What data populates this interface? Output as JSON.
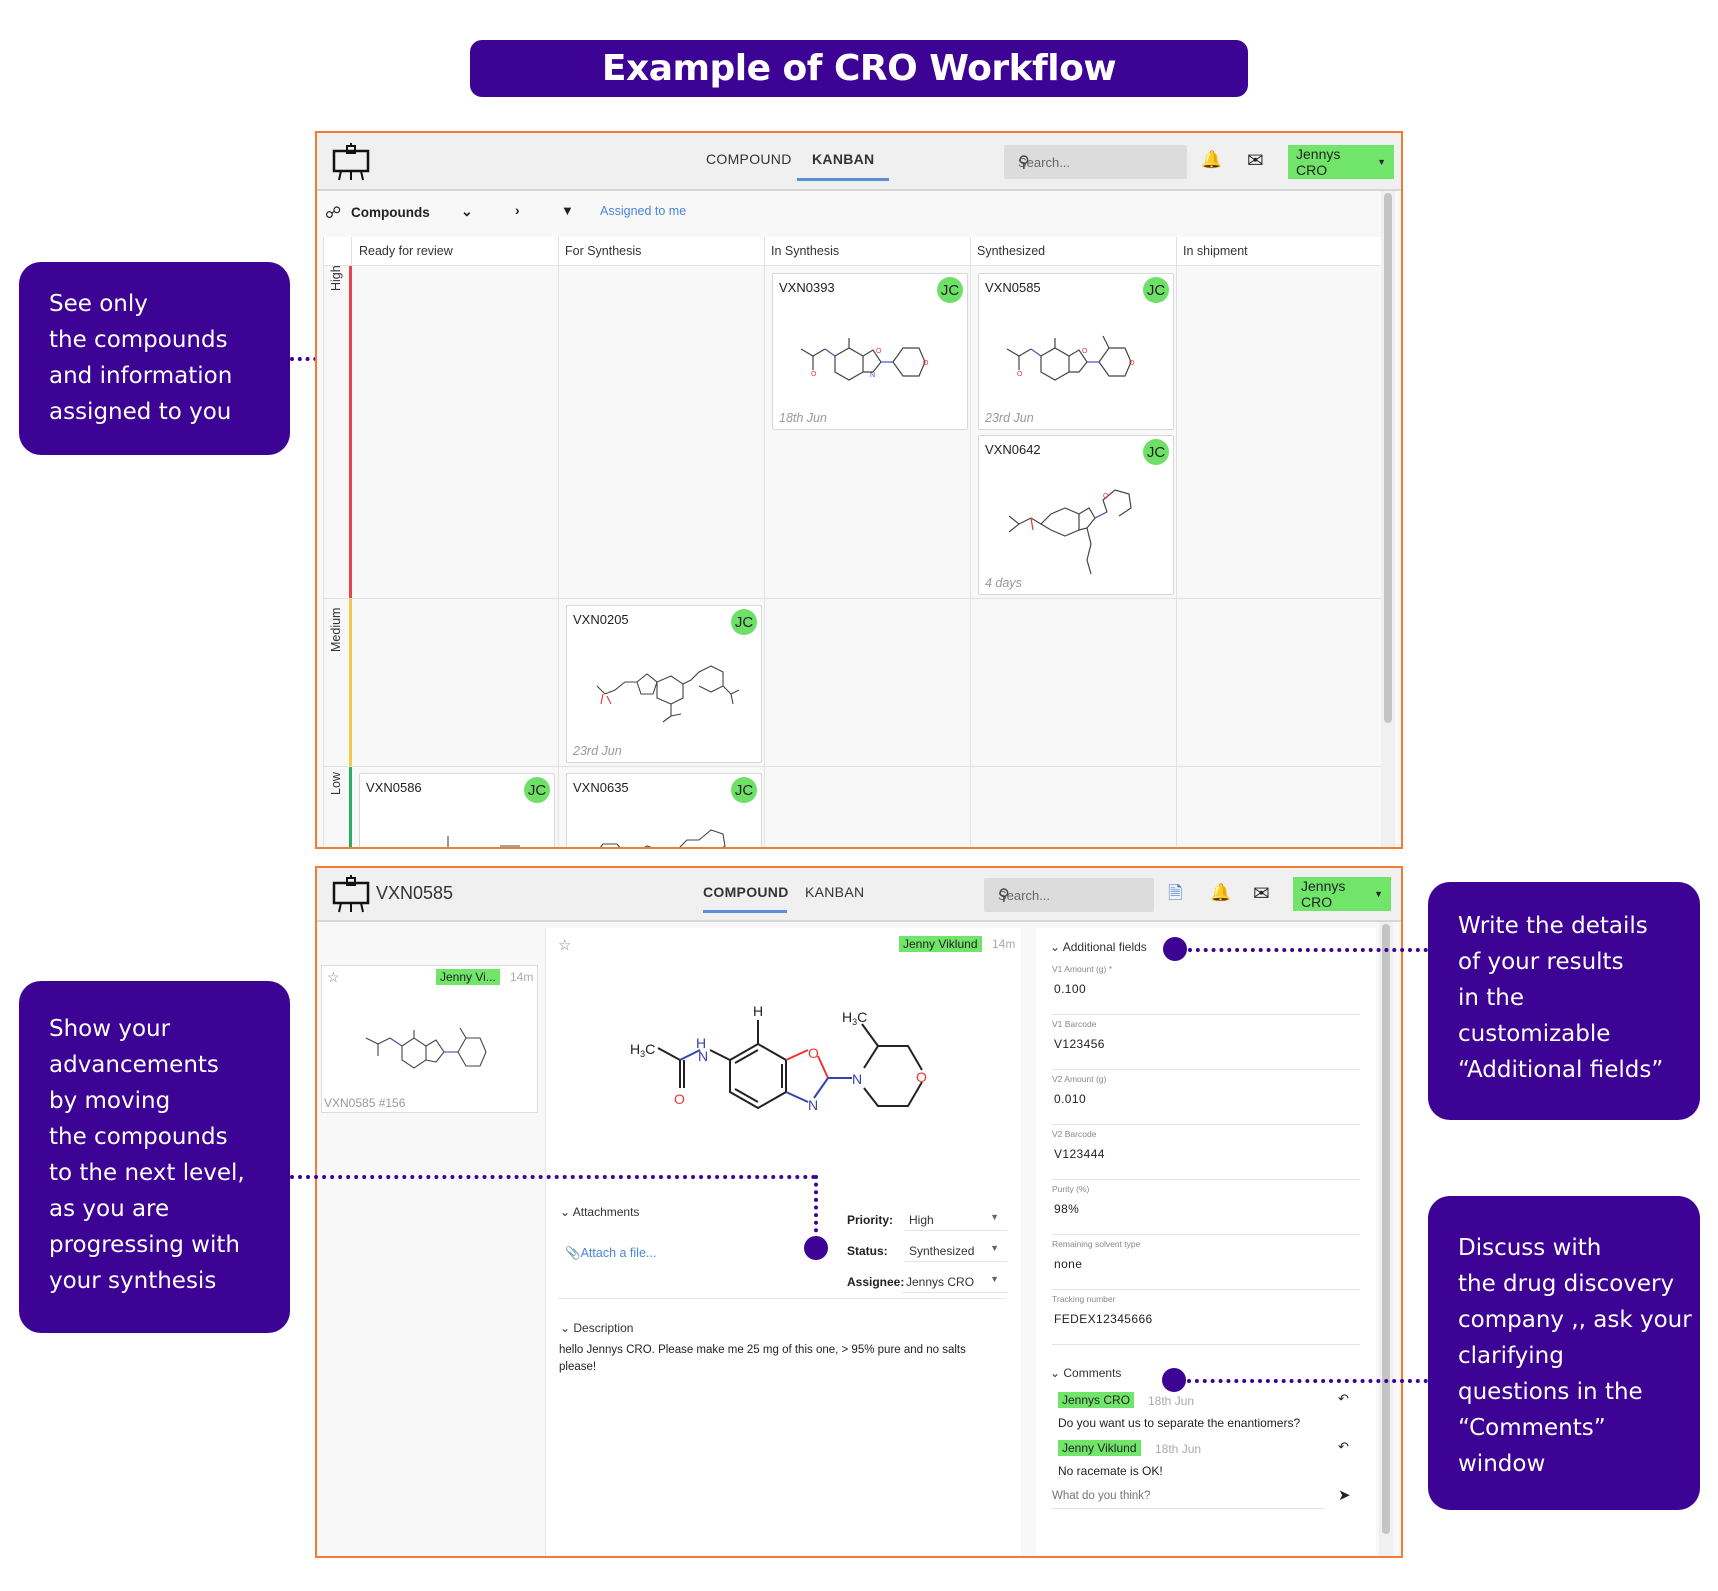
{
  "title": "Example of CRO Workflow",
  "callouts": {
    "assigned": [
      "See only",
      "the compounds",
      "and information",
      "assigned to you"
    ],
    "advance": [
      "Show your",
      "advancements",
      "by moving",
      "the compounds",
      "to the next level,",
      "as you are",
      "progressing with",
      "your synthesis"
    ],
    "fields": [
      "Write the details",
      "of your results",
      "in the",
      "customizable",
      "“Additional fields”"
    ],
    "comments": [
      "Discuss with",
      "the drug discovery",
      "company ,, ask your",
      "clarifying",
      "questions in the",
      "“Comments”",
      "window"
    ]
  },
  "colors": {
    "brand": "#3d0394",
    "accent_border": "#f27b35",
    "user_green": "#70e56a",
    "link_blue": "#4a86d8",
    "high": "#e8434d",
    "medium": "#f2c94c",
    "low": "#27ae60"
  },
  "kanban_view": {
    "nav": {
      "compound": "COMPOUND",
      "kanban": "KANBAN",
      "active": "KANBAN"
    },
    "search_placeholder": "Search...",
    "user_menu": "Jennys CRO",
    "icons": [
      "app-logo-easel-icon",
      "search-icon",
      "bell-icon",
      "mail-icon",
      "caret-down-icon"
    ],
    "toolbar": {
      "collection": "Compounds",
      "filter_label": "Assigned to me"
    },
    "columns": [
      "Ready for review",
      "For Synthesis",
      "In Synthesis",
      "Synthesized",
      "In shipment"
    ],
    "priorities": [
      "High",
      "Medium",
      "Low"
    ],
    "cards": [
      {
        "id": "VXN0393",
        "assignee": "JC",
        "date": "18th Jun",
        "column": "In Synthesis",
        "priority": "High"
      },
      {
        "id": "VXN0585",
        "assignee": "JC",
        "date": "23rd Jun",
        "column": "Synthesized",
        "priority": "High"
      },
      {
        "id": "VXN0642",
        "assignee": "JC",
        "date": "4 days",
        "column": "Synthesized",
        "priority": "High"
      },
      {
        "id": "VXN0205",
        "assignee": "JC",
        "date": "23rd Jun",
        "column": "For Synthesis",
        "priority": "Medium"
      },
      {
        "id": "VXN0586",
        "assignee": "JC",
        "date": "",
        "column": "Ready for review",
        "priority": "Low"
      },
      {
        "id": "VXN0635",
        "assignee": "JC",
        "date": "",
        "column": "For Synthesis",
        "priority": "Low"
      }
    ]
  },
  "compound_view": {
    "title": "VXN0585",
    "nav": {
      "compound": "COMPOUND",
      "kanban": "KANBAN",
      "active": "COMPOUND"
    },
    "search_placeholder": "Search...",
    "user_menu": "Jennys CRO",
    "thumb": {
      "author": "Jenny Vi...",
      "time": "14m",
      "caption": "VXN0585 #156"
    },
    "main": {
      "author": "Jenny Viklund",
      "time": "14m",
      "attachments_label": "Attachments",
      "attach_link": "Attach a file...",
      "priority_label": "Priority:",
      "priority_value": "High",
      "status_label": "Status:",
      "status_value": "Synthesized",
      "assignee_label": "Assignee:",
      "assignee_value": "Jennys CRO",
      "description_label": "Description",
      "description": "hello Jennys CRO. Please make me 25 mg of this one, > 95% pure and no salts please!"
    },
    "additional_fields_label": "Additional fields",
    "fields": [
      {
        "label": "V1 Amount (g) *",
        "value": "0.100"
      },
      {
        "label": "V1 Barcode",
        "value": "V123456"
      },
      {
        "label": "V2 Amount (g)",
        "value": "0.010"
      },
      {
        "label": "V2 Barcode",
        "value": "V123444"
      },
      {
        "label": "Purity (%)",
        "value": "98%"
      },
      {
        "label": "Remaining solvent type",
        "value": "none"
      },
      {
        "label": "Tracking number",
        "value": "FEDEX12345666"
      }
    ],
    "comments_label": "Comments",
    "comments": [
      {
        "author": "Jennys CRO",
        "date": "18th Jun",
        "text": "Do you want us to separate the enantiomers?"
      },
      {
        "author": "Jenny Viklund",
        "date": "18th Jun",
        "text": "No racemate is OK!"
      }
    ],
    "comment_placeholder": "What do you think?"
  }
}
